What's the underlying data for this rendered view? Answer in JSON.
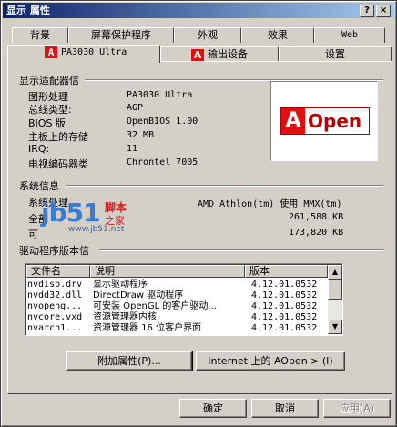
{
  "window": {
    "title": "显示 属性",
    "help_btn": "?",
    "close_btn": "×"
  },
  "tabs": {
    "row1": [
      "背景",
      "屏幕保护程序",
      "外观",
      "效果",
      "Web"
    ],
    "row2": {
      "active": "PA3030 Ultra",
      "output": "输出设备",
      "settings": "设置"
    },
    "logo_letter": "A"
  },
  "adapter": {
    "group_title": "显示适配器信",
    "rows": [
      {
        "label": "图形处理",
        "value": "PA3030 Ultra"
      },
      {
        "label": "总线类型:",
        "value": "AGP"
      },
      {
        "label": "BIOS 版",
        "value": "OpenBIOS 1.00"
      },
      {
        "label": "主板上的存储",
        "value": "32 MB"
      },
      {
        "label": "IRQ:",
        "value": "11"
      },
      {
        "label": "电视编码器类",
        "value": "Chrontel 7005"
      }
    ],
    "brand_logo": {
      "a": "A",
      "text": "Open"
    }
  },
  "system": {
    "group_title": "系统信息",
    "rows": [
      {
        "label": "系统处理",
        "value": "AMD Athlon(tm) 使用 MMX(tm)"
      },
      {
        "label": "全部",
        "value": "261,588 KB"
      },
      {
        "label": "可",
        "value": "173,820 KB"
      }
    ]
  },
  "watermark": {
    "jb": "jb51",
    "line1": "脚本",
    "line2": "之家",
    "url": "www.jb51.net"
  },
  "drivers": {
    "group_title": "驱动程序版本信",
    "columns": [
      "文件名",
      "说明",
      "版本"
    ],
    "rows": [
      {
        "file": "nvdisp.drv",
        "desc": "显示驱动程序",
        "version": "4.12.01.0532"
      },
      {
        "file": "nvdd32.dll",
        "desc": "DirectDraw 驱动程序",
        "version": "4.12.01.0532"
      },
      {
        "file": "nvopeng...",
        "desc": "可安装 OpenGL 的客户驱动...",
        "version": "4.12.01.0532"
      },
      {
        "file": "nvcore.vxd",
        "desc": "资源管理器内核",
        "version": "4.12.01.0532"
      },
      {
        "file": "nvarch1...",
        "desc": "资源管理器 16 位客户界面",
        "version": "4.12.01.0532"
      }
    ]
  },
  "buttons": {
    "extra_props": "附加属性(P)...",
    "internet": "Internet 上的 AOpen  > (I)",
    "ok": "确定",
    "cancel": "取消",
    "apply": "应用(A)"
  }
}
